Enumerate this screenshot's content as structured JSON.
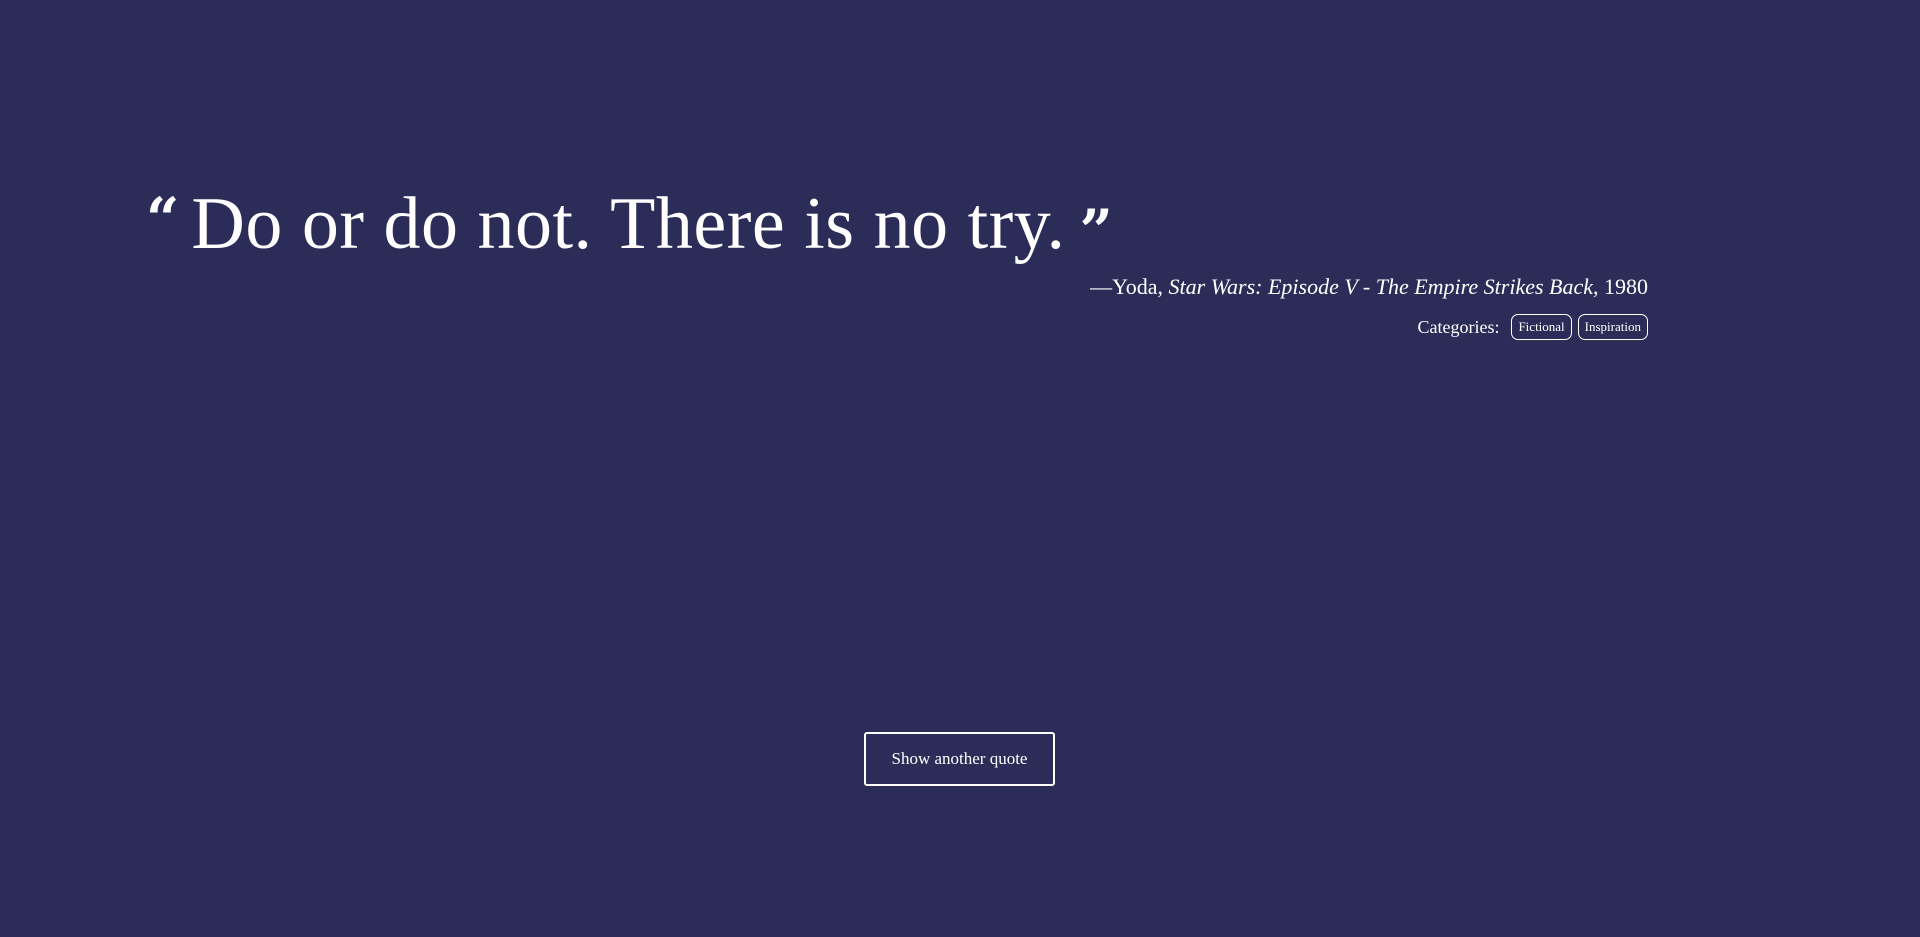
{
  "colors": {
    "background": "#2c2c58",
    "foreground": "#ffffff"
  },
  "quote": {
    "open_mark": "“",
    "text": "Do or do not. There is no try.",
    "close_mark": "”"
  },
  "attribution": {
    "prefix": "—Yoda, ",
    "work": "Star Wars: Episode V - The Empire Strikes Back",
    "suffix": ", 1980"
  },
  "categories": {
    "label": "Categories:",
    "tags": [
      "Fictional",
      "Inspiration"
    ]
  },
  "actions": {
    "show_another_label": "Show another quote"
  }
}
